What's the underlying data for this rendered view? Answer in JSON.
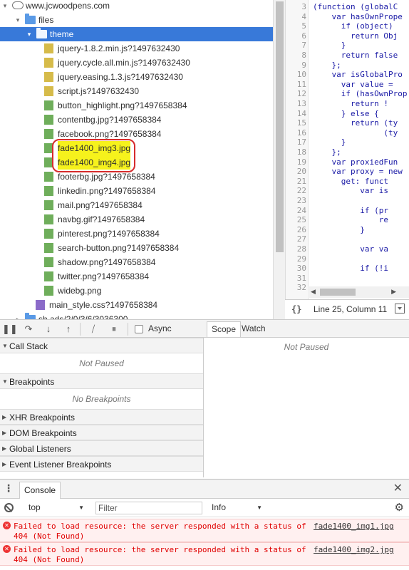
{
  "file_tree": {
    "items": [
      {
        "label": "www.jcwoodpens.com",
        "icon": "cloud-icon",
        "indent": 0,
        "arrow": "▾"
      },
      {
        "label": "files",
        "icon": "folder-icon",
        "indent": 1,
        "arrow": "▾"
      },
      {
        "label": "theme",
        "icon": "folder-icon",
        "indent": 2,
        "arrow": "▾",
        "selected": true
      },
      {
        "label": "jquery-1.8.2.min.js?1497632430",
        "icon": "js-file-icon",
        "indent": 3
      },
      {
        "label": "jquery.cycle.all.min.js?1497632430",
        "icon": "js-file-icon",
        "indent": 3
      },
      {
        "label": "jquery.easing.1.3.js?1497632430",
        "icon": "js-file-icon",
        "indent": 3
      },
      {
        "label": "script.js?1497632430",
        "icon": "js-file-icon",
        "indent": 3
      },
      {
        "label": "button_highlight.png?1497658384",
        "icon": "image-file-icon",
        "indent": 3
      },
      {
        "label": "contentbg.jpg?1497658384",
        "icon": "image-file-icon",
        "indent": 3
      },
      {
        "label": "facebook.png?1497658384",
        "icon": "image-file-icon",
        "indent": 3
      },
      {
        "label": "fade1400_img3.jpg",
        "icon": "image-file-icon",
        "indent": 3,
        "highlighted": true
      },
      {
        "label": "fade1400_img4.jpg",
        "icon": "image-file-icon",
        "indent": 3,
        "highlighted": true
      },
      {
        "label": "footerbg.jpg?1497658384",
        "icon": "image-file-icon",
        "indent": 3
      },
      {
        "label": "linkedin.png?1497658384",
        "icon": "image-file-icon",
        "indent": 3
      },
      {
        "label": "mail.png?1497658384",
        "icon": "image-file-icon",
        "indent": 3
      },
      {
        "label": "navbg.gif?1497658384",
        "icon": "image-file-icon",
        "indent": 3
      },
      {
        "label": "pinterest.png?1497658384",
        "icon": "image-file-icon",
        "indent": 3
      },
      {
        "label": "search-button.png?1497658384",
        "icon": "image-file-icon",
        "indent": 3
      },
      {
        "label": "shadow.png?1497658384",
        "icon": "image-file-icon",
        "indent": 3
      },
      {
        "label": "twitter.png?1497658384",
        "icon": "image-file-icon",
        "indent": 3
      },
      {
        "label": "widebg.png",
        "icon": "image-file-icon",
        "indent": 3
      },
      {
        "label": "main_style.css?1497658384",
        "icon": "css-file-icon",
        "indent": 2
      },
      {
        "label": "sh.ads/2/0/3/6/3036300",
        "icon": "folder-icon",
        "indent": 1,
        "arrow": "▸"
      }
    ]
  },
  "editor": {
    "lines": [
      {
        "num": "3",
        "text": "(function (globalC"
      },
      {
        "num": "4",
        "text": "    var hasOwnPrope"
      },
      {
        "num": "5",
        "text": "      if (object)"
      },
      {
        "num": "6",
        "text": "        return Obj"
      },
      {
        "num": "7",
        "text": "      }"
      },
      {
        "num": "8",
        "text": "      return false"
      },
      {
        "num": "9",
        "text": "    };"
      },
      {
        "num": "10",
        "text": "    var isGlobalPro"
      },
      {
        "num": "11",
        "text": "      var value ="
      },
      {
        "num": "12",
        "text": "      if (hasOwnProp"
      },
      {
        "num": "13",
        "text": "        return !"
      },
      {
        "num": "14",
        "text": "      } else {"
      },
      {
        "num": "15",
        "text": "        return (ty"
      },
      {
        "num": "16",
        "text": "               (ty"
      },
      {
        "num": "17",
        "text": "      }"
      },
      {
        "num": "18",
        "text": "    };"
      },
      {
        "num": "19",
        "text": "    var proxiedFun"
      },
      {
        "num": "20",
        "text": "    var proxy = new"
      },
      {
        "num": "21",
        "text": "      get: funct"
      },
      {
        "num": "22",
        "text": "          var is"
      },
      {
        "num": "23",
        "text": ""
      },
      {
        "num": "24",
        "text": "          if (pr"
      },
      {
        "num": "25",
        "text": "              re"
      },
      {
        "num": "26",
        "text": "          }"
      },
      {
        "num": "27",
        "text": ""
      },
      {
        "num": "28",
        "text": "          var va"
      },
      {
        "num": "29",
        "text": ""
      },
      {
        "num": "30",
        "text": "          if (!i"
      },
      {
        "num": "31",
        "text": "              "
      },
      {
        "num": "32",
        "text": ""
      }
    ],
    "status": {
      "braces": "{}",
      "position": "Line 25, Column 11"
    }
  },
  "debug_toolbar": {
    "async_label": "Async",
    "tabs": [
      "Scope",
      "Watch"
    ]
  },
  "sidebar_panes": {
    "call_stack": {
      "title": "Call Stack",
      "empty": "Not Paused"
    },
    "breakpoints": {
      "title": "Breakpoints",
      "empty": "No Breakpoints"
    },
    "xhr": {
      "title": "XHR Breakpoints"
    },
    "dom": {
      "title": "DOM Breakpoints"
    },
    "global": {
      "title": "Global Listeners"
    },
    "event": {
      "title": "Event Listener Breakpoints"
    }
  },
  "scope_pane": {
    "status": "Not Paused"
  },
  "console": {
    "tab_label": "Console",
    "context": "top",
    "filter_placeholder": "Filter",
    "level": "Info",
    "messages": [
      {
        "text": "Failed to load resource: the server responded with a status of 404 (Not Found)",
        "source": "fade1400_img1.jpg"
      },
      {
        "text": "Failed to load resource: the server responded with a status of 404 (Not Found)",
        "source": "fade1400_img2.jpg"
      }
    ]
  },
  "colors": {
    "selection": "#3879d9",
    "highlight": "#f6f21c",
    "highlight_border": "#d62b2b",
    "error": "#e00000"
  }
}
